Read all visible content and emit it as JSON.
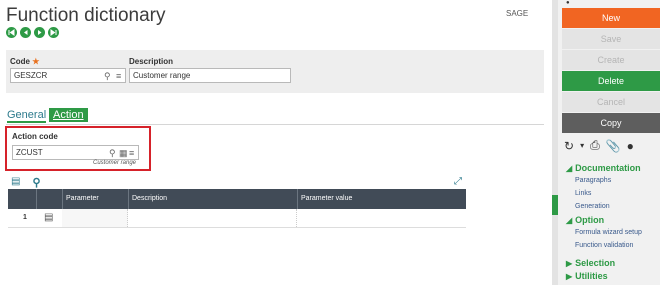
{
  "page": {
    "title": "Function dictionary",
    "company": "SAGE"
  },
  "header": {
    "code_label": "Code",
    "code_required": "★",
    "code_value": "GESZCR",
    "description_label": "Description",
    "description_value": "Customer range"
  },
  "tabs": [
    {
      "label": "General"
    },
    {
      "label": "Action"
    }
  ],
  "action": {
    "code_label": "Action code",
    "code_value": "ZCUST",
    "code_hint": "Customer range"
  },
  "grid": {
    "columns": [
      "Parameter",
      "Description",
      "Parameter value"
    ],
    "rows": [
      {
        "num": "1"
      }
    ]
  },
  "actions": {
    "new": "New",
    "save": "Save",
    "create": "Create",
    "delete": "Delete",
    "cancel": "Cancel",
    "copy": "Copy"
  },
  "sidebar": {
    "documentation": "Documentation",
    "doc_links": [
      "Paragraphs",
      "Links",
      "Generation"
    ],
    "option": "Option",
    "option_links": [
      "Formula wizard setup",
      "Function validation"
    ],
    "selection": "Selection",
    "utilities": "Utilities"
  },
  "colors": {
    "green": "#2e9a46",
    "orange": "#f16522",
    "darkgrey": "#5e5e5e",
    "red_highlight": "#d6222a"
  }
}
